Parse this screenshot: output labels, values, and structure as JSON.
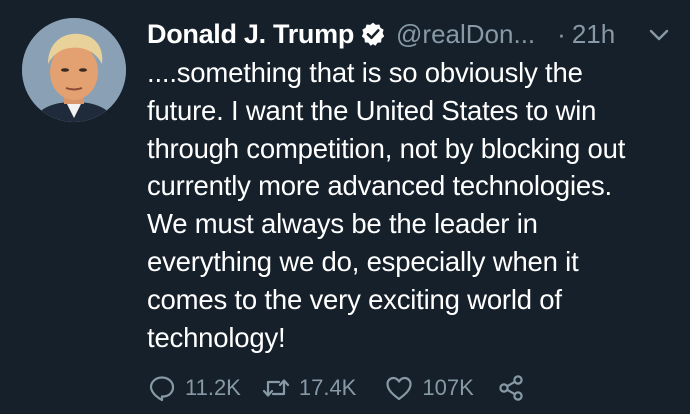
{
  "tweet": {
    "display_name": "Donald J. Trump",
    "verified_icon": "verified-badge-icon",
    "handle": "@realDon...",
    "separator": "·",
    "time": "21h",
    "caret_icon": "chevron-down-icon",
    "text": "....something that is so obviously the\nfuture. I want the United States to win\nthrough competition, not by blocking out\ncurrently more advanced technologies.\nWe must always be the leader in\neverything we do, especially when it\ncomes to the very exciting world of\ntechnology!"
  },
  "actions": {
    "reply": {
      "icon": "reply-icon",
      "count": "11.2K"
    },
    "retweet": {
      "icon": "retweet-icon",
      "count": "17.4K"
    },
    "like": {
      "icon": "heart-icon",
      "count": "107K"
    },
    "share": {
      "icon": "share-icon"
    }
  },
  "colors": {
    "background": "#15202b",
    "primary_text": "#ffffff",
    "secondary_text": "#8899a6"
  }
}
